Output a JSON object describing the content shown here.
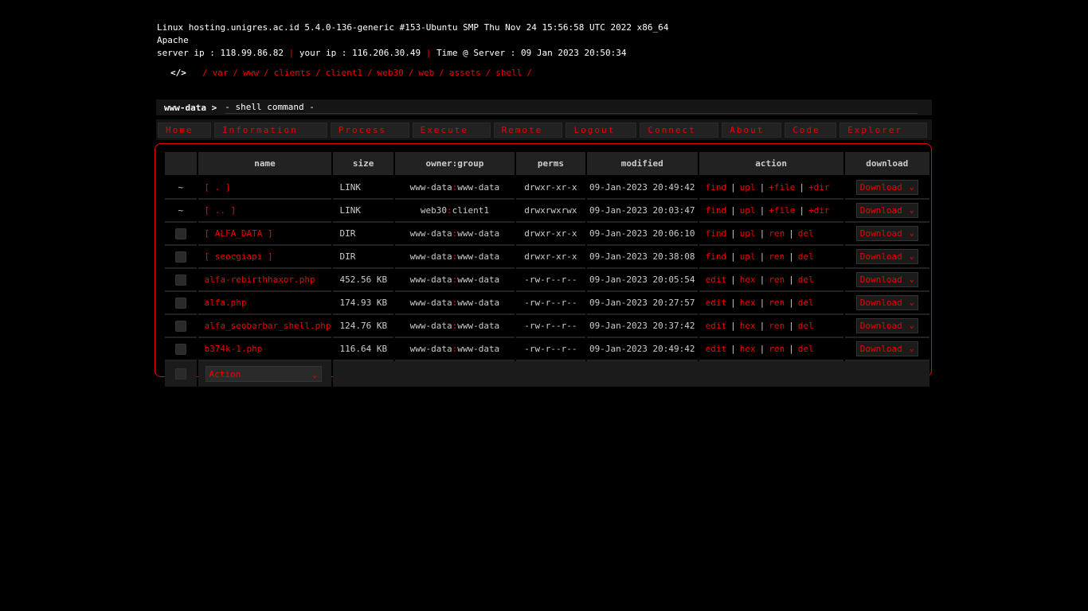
{
  "sysinfo": {
    "uname": "Linux hosting.unigres.ac.id 5.4.0-136-generic #153-Ubuntu SMP Thu Nov 24 15:56:58 UTC 2022 x86_64",
    "software": "Apache",
    "server_ip": "server ip : 118.99.86.82",
    "sep": "|",
    "your_ip": "your ip : 116.206.30.49",
    "time": "Time @ Server : 09 Jan 2023 20:50:34"
  },
  "path": {
    "icon": "</>",
    "segments": [
      "var",
      "www",
      "clients",
      "client1",
      "web30",
      "web",
      "assets",
      "shell"
    ],
    "separator": "/"
  },
  "shell": {
    "user": "www-data >",
    "placeholder": "- shell command -"
  },
  "menu": [
    "Home",
    "Information",
    "Process",
    "Execute",
    "Remote",
    "Logout",
    "Connect",
    "About",
    "Code",
    "Explorer"
  ],
  "table": {
    "headers": [
      "name",
      "size",
      "owner:group",
      "perms",
      "modified",
      "action",
      "download"
    ],
    "rows": [
      {
        "mark": "~",
        "name": "[ . ]",
        "size": "LINK",
        "owner": "www-data",
        "group": "www-data",
        "perms": "drwxr-xr-x",
        "modified": "09-Jan-2023 20:49:42",
        "actions": [
          "find",
          "upl",
          "+file",
          "+dir"
        ],
        "download": "Download"
      },
      {
        "mark": "~",
        "name": "[ .. ]",
        "size": "LINK",
        "owner": "web30",
        "group": "client1",
        "perms": "drwxrwxrwx",
        "modified": "09-Jan-2023 20:03:47",
        "actions": [
          "find",
          "upl",
          "+file",
          "+dir"
        ],
        "download": "Download"
      },
      {
        "mark": "",
        "name": "[ ALFA_DATA ]",
        "size": "DIR",
        "owner": "www-data",
        "group": "www-data",
        "perms": "drwxr-xr-x",
        "modified": "09-Jan-2023 20:06:10",
        "actions": [
          "find",
          "upl",
          "ren",
          "del"
        ],
        "download": "Download"
      },
      {
        "mark": "",
        "name": "[ seocgiapi ]",
        "size": "DIR",
        "owner": "www-data",
        "group": "www-data",
        "perms": "drwxr-xr-x",
        "modified": "09-Jan-2023 20:38:08",
        "actions": [
          "find",
          "upl",
          "ren",
          "del"
        ],
        "download": "Download"
      },
      {
        "mark": "",
        "name": "alfa-rebirthhaxor.php",
        "size": "452.56 KB",
        "owner": "www-data",
        "group": "www-data",
        "perms": "-rw-r--r--",
        "modified": "09-Jan-2023 20:05:54",
        "actions": [
          "edit",
          "hex",
          "ren",
          "del"
        ],
        "download": "Download"
      },
      {
        "mark": "",
        "name": "alfa.php",
        "size": "174.93 KB",
        "owner": "www-data",
        "group": "www-data",
        "perms": "-rw-r--r--",
        "modified": "09-Jan-2023 20:27:57",
        "actions": [
          "edit",
          "hex",
          "ren",
          "del"
        ],
        "download": "Download"
      },
      {
        "mark": "",
        "name": "alfa_seobarbar_shell.php",
        "size": "124.76 KB",
        "owner": "www-data",
        "group": "www-data",
        "perms": "-rw-r--r--",
        "modified": "09-Jan-2023 20:37:42",
        "actions": [
          "edit",
          "hex",
          "ren",
          "del"
        ],
        "download": "Download"
      },
      {
        "mark": "",
        "name": "b374k-1.php",
        "size": "116.64 KB",
        "owner": "www-data",
        "group": "www-data",
        "perms": "-rw-r--r--",
        "modified": "09-Jan-2023 20:49:42",
        "actions": [
          "edit",
          "hex",
          "ren",
          "del"
        ],
        "download": "Download"
      }
    ],
    "footer_select": "Action"
  },
  "colors": {
    "accent": "#ee0000",
    "background": "#000000",
    "panel": "#151515"
  }
}
